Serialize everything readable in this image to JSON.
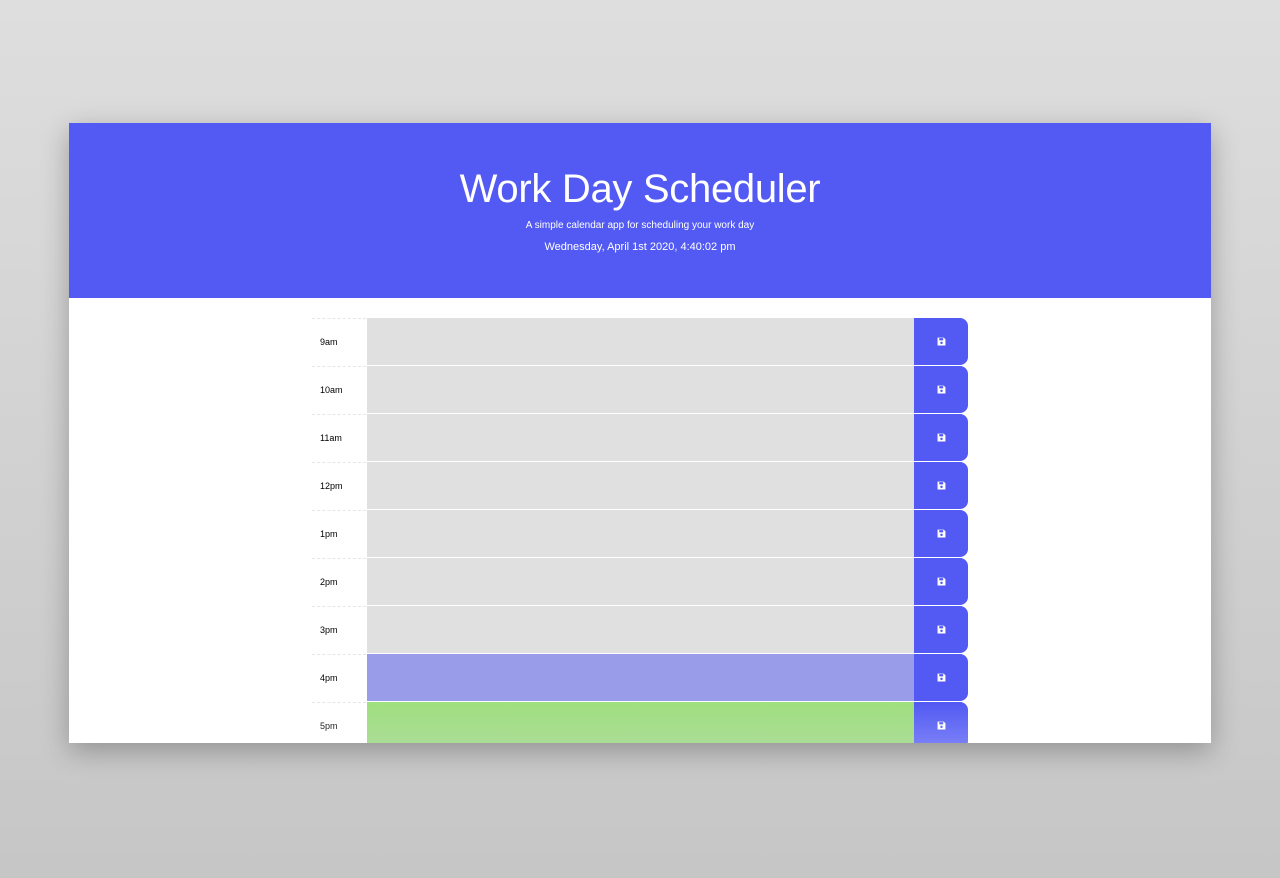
{
  "header": {
    "title": "Work Day Scheduler",
    "subtitle": "A simple calendar app for scheduling your work day",
    "current_datetime": "Wednesday, April 1st 2020, 4:40:02 pm"
  },
  "time_blocks": [
    {
      "hour": "9am",
      "text": "",
      "status": "past"
    },
    {
      "hour": "10am",
      "text": "",
      "status": "past"
    },
    {
      "hour": "11am",
      "text": "",
      "status": "past"
    },
    {
      "hour": "12pm",
      "text": "",
      "status": "past"
    },
    {
      "hour": "1pm",
      "text": "",
      "status": "past"
    },
    {
      "hour": "2pm",
      "text": "",
      "status": "past"
    },
    {
      "hour": "3pm",
      "text": "",
      "status": "past"
    },
    {
      "hour": "4pm",
      "text": "",
      "status": "present"
    },
    {
      "hour": "5pm",
      "text": "",
      "status": "future"
    }
  ],
  "icons": {
    "save": "save-icon"
  },
  "colors": {
    "header_bg": "#525af3",
    "save_button": "#525af3",
    "past": "#e0e0e0",
    "present": "#999ce9",
    "future": "#a0e080"
  }
}
